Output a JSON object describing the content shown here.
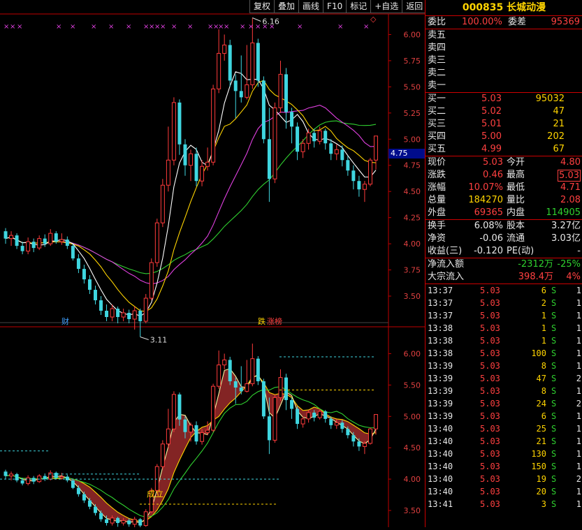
{
  "toolbar": {
    "buttons": [
      "复权",
      "叠加",
      "画线",
      "F10",
      "标记",
      "+自选",
      "返回"
    ]
  },
  "stock": {
    "code": "000835",
    "name": "长城动漫"
  },
  "main_chart": {
    "price_axis": [
      "6.00",
      "5.75",
      "5.50",
      "5.25",
      "5.00",
      "4.75",
      "4.50",
      "4.25",
      "4.00",
      "3.75",
      "3.50"
    ],
    "current_price_tag": "4.75",
    "high_label": "6.16",
    "low_label": "3.11",
    "event_marks": [
      "财",
      "跌",
      "涨榜"
    ]
  },
  "sub_chart": {
    "price_axis": [
      "6.00",
      "5.50",
      "5.00",
      "4.50",
      "4.00",
      "3.50"
    ],
    "annotation": "成立"
  },
  "quote": {
    "weibi_label": "委比",
    "weibi_value": "100.00%",
    "weicha_label": "委差",
    "weicha_value": "95369",
    "asks": [
      {
        "label": "卖五"
      },
      {
        "label": "卖四"
      },
      {
        "label": "卖三"
      },
      {
        "label": "卖二"
      },
      {
        "label": "卖一"
      }
    ],
    "bids": [
      {
        "label": "买一",
        "price": "5.03",
        "vol": "95032"
      },
      {
        "label": "买二",
        "price": "5.02",
        "vol": "47"
      },
      {
        "label": "买三",
        "price": "5.01",
        "vol": "21"
      },
      {
        "label": "买四",
        "price": "5.00",
        "vol": "202"
      },
      {
        "label": "买五",
        "price": "4.99",
        "vol": "67"
      }
    ],
    "stats": [
      {
        "l1": "现价",
        "v1": "5.03",
        "c1": "red",
        "l2": "今开",
        "v2": "4.80",
        "c2": "red"
      },
      {
        "l1": "涨跌",
        "v1": "0.46",
        "c1": "red",
        "l2": "最高",
        "v2": "5.03",
        "c2": "red"
      },
      {
        "l1": "涨幅",
        "v1": "10.07%",
        "c1": "red",
        "l2": "最低",
        "v2": "4.71",
        "c2": "red"
      },
      {
        "l1": "总量",
        "v1": "184270",
        "c1": "yellow",
        "l2": "量比",
        "v2": "2.08",
        "c2": "red"
      },
      {
        "l1": "外盘",
        "v1": "69365",
        "c1": "red",
        "l2": "内盘",
        "v2": "114905",
        "c2": "green"
      }
    ],
    "stats2": [
      {
        "l1": "换手",
        "v1": "6.08%",
        "l2": "股本",
        "v2": "3.27亿"
      },
      {
        "l1": "净资",
        "v1": "-0.06",
        "l2": "流通",
        "v2": "3.03亿"
      },
      {
        "l1": "收益(三)",
        "v1": "-0.120",
        "l2": "PE(动)",
        "v2": "-"
      }
    ],
    "flow": [
      {
        "label": "净流入额",
        "value": "-2312万",
        "pct": "-25%",
        "vcolor": "green",
        "pcolor": "green"
      },
      {
        "label": "大宗流入",
        "value": "398.4万",
        "pct": "4%",
        "vcolor": "red",
        "pcolor": "red"
      }
    ]
  },
  "ticks": [
    {
      "time": "13:37",
      "price": "5.03",
      "vol": "6",
      "side": "S",
      "n": "1"
    },
    {
      "time": "13:37",
      "price": "5.03",
      "vol": "2",
      "side": "S",
      "n": "1"
    },
    {
      "time": "13:37",
      "price": "5.03",
      "vol": "1",
      "side": "S",
      "n": "1"
    },
    {
      "time": "13:38",
      "price": "5.03",
      "vol": "1",
      "side": "S",
      "n": "1"
    },
    {
      "time": "13:38",
      "price": "5.03",
      "vol": "1",
      "side": "S",
      "n": "1"
    },
    {
      "time": "13:38",
      "price": "5.03",
      "vol": "100",
      "side": "S",
      "n": "1"
    },
    {
      "time": "13:39",
      "price": "5.03",
      "vol": "8",
      "side": "S",
      "n": "1"
    },
    {
      "time": "13:39",
      "price": "5.03",
      "vol": "47",
      "side": "S",
      "n": "2"
    },
    {
      "time": "13:39",
      "price": "5.03",
      "vol": "8",
      "side": "S",
      "n": "1"
    },
    {
      "time": "13:39",
      "price": "5.03",
      "vol": "24",
      "side": "S",
      "n": "2"
    },
    {
      "time": "13:39",
      "price": "5.03",
      "vol": "6",
      "side": "S",
      "n": "1"
    },
    {
      "time": "13:40",
      "price": "5.03",
      "vol": "25",
      "side": "S",
      "n": "1"
    },
    {
      "time": "13:40",
      "price": "5.03",
      "vol": "21",
      "side": "S",
      "n": "1"
    },
    {
      "time": "13:40",
      "price": "5.03",
      "vol": "130",
      "side": "S",
      "n": "1"
    },
    {
      "time": "13:40",
      "price": "5.03",
      "vol": "150",
      "side": "S",
      "n": "1"
    },
    {
      "time": "13:40",
      "price": "5.03",
      "vol": "19",
      "side": "S",
      "n": "2"
    },
    {
      "time": "13:40",
      "price": "5.03",
      "vol": "20",
      "side": "S",
      "n": "1"
    },
    {
      "time": "13:41",
      "price": "5.03",
      "vol": "3",
      "side": "S",
      "n": "1"
    }
  ],
  "colors": {
    "up": "#ff3b3b",
    "down": "#3fd6e0",
    "ma5": "#ffffff",
    "ma10": "#ffd400",
    "ma20": "#e040e0",
    "ma60": "#30d030",
    "border": "#c00000"
  },
  "chart_data": {
    "type": "candlestick",
    "ma_lines": [
      "MA5",
      "MA10",
      "MA20",
      "MA60"
    ],
    "ylim_main": [
      3.3,
      6.25
    ],
    "ylim_sub": [
      3.3,
      6.25
    ],
    "candles": [
      [
        4.12,
        4.05,
        4.15,
        4.0
      ],
      [
        4.05,
        4.08,
        4.12,
        3.98
      ],
      [
        4.08,
        3.98,
        4.1,
        3.95
      ],
      [
        3.98,
        3.93,
        4.02,
        3.9
      ],
      [
        3.93,
        4.02,
        4.06,
        3.9
      ],
      [
        4.02,
        3.96,
        4.05,
        3.92
      ],
      [
        3.96,
        4.05,
        4.08,
        3.94
      ],
      [
        4.05,
        4.0,
        4.09,
        3.97
      ],
      [
        4.0,
        4.1,
        4.14,
        3.98
      ],
      [
        4.1,
        4.02,
        4.12,
        4.0
      ],
      [
        4.02,
        4.04,
        4.1,
        3.99
      ],
      [
        4.04,
        3.98,
        4.07,
        3.95
      ],
      [
        3.98,
        3.86,
        4.0,
        3.84
      ],
      [
        3.86,
        3.76,
        3.9,
        3.72
      ],
      [
        3.76,
        3.66,
        3.8,
        3.62
      ],
      [
        3.66,
        3.56,
        3.7,
        3.52
      ],
      [
        3.56,
        3.46,
        3.6,
        3.42
      ],
      [
        3.46,
        3.36,
        3.5,
        3.32
      ],
      [
        3.36,
        3.3,
        3.42,
        3.26
      ],
      [
        3.3,
        3.38,
        3.42,
        3.26
      ],
      [
        3.38,
        3.3,
        3.4,
        3.24
      ],
      [
        3.3,
        3.34,
        3.38,
        3.26
      ],
      [
        3.34,
        3.28,
        3.37,
        3.24
      ],
      [
        3.28,
        3.36,
        3.4,
        3.18
      ],
      [
        3.36,
        3.26,
        3.38,
        3.11
      ],
      [
        3.26,
        3.48,
        3.52,
        3.24
      ],
      [
        3.48,
        3.82,
        3.86,
        3.46
      ],
      [
        3.82,
        4.2,
        4.24,
        3.78
      ],
      [
        4.2,
        4.56,
        4.62,
        4.16
      ],
      [
        4.56,
        4.8,
        5.12,
        4.5
      ],
      [
        4.8,
        5.35,
        5.4,
        4.75
      ],
      [
        5.35,
        4.95,
        5.38,
        4.85
      ],
      [
        4.95,
        4.75,
        5.0,
        4.65
      ],
      [
        4.75,
        4.86,
        4.9,
        4.6
      ],
      [
        4.86,
        4.6,
        4.92,
        4.55
      ],
      [
        4.6,
        4.74,
        4.8,
        4.55
      ],
      [
        4.74,
        4.78,
        4.92,
        4.7
      ],
      [
        4.78,
        5.48,
        5.52,
        4.75
      ],
      [
        5.48,
        5.82,
        6.05,
        5.44
      ],
      [
        5.82,
        5.9,
        6.0,
        5.75
      ],
      [
        5.9,
        5.56,
        5.95,
        5.5
      ],
      [
        5.56,
        5.46,
        5.62,
        5.2
      ],
      [
        5.46,
        5.4,
        5.8,
        5.35
      ],
      [
        5.4,
        5.52,
        5.9,
        5.38
      ],
      [
        5.52,
        5.92,
        6.16,
        5.48
      ],
      [
        5.92,
        5.56,
        5.96,
        5.5
      ],
      [
        5.56,
        5.0,
        5.6,
        4.96
      ],
      [
        5.0,
        4.62,
        5.3,
        4.4
      ],
      [
        4.62,
        5.3,
        5.35,
        4.58
      ],
      [
        5.3,
        5.62,
        5.75,
        5.25
      ],
      [
        5.62,
        5.26,
        5.68,
        5.1
      ],
      [
        5.26,
        5.12,
        5.3,
        4.96
      ],
      [
        5.12,
        4.88,
        5.16,
        4.8
      ],
      [
        4.88,
        4.96,
        5.0,
        4.82
      ],
      [
        4.96,
        5.06,
        5.1,
        4.9
      ],
      [
        5.06,
        4.98,
        5.1,
        4.92
      ],
      [
        4.98,
        5.08,
        5.12,
        4.95
      ],
      [
        5.08,
        4.96,
        5.1,
        4.9
      ],
      [
        4.96,
        4.86,
        5.0,
        4.8
      ],
      [
        4.86,
        4.9,
        4.95,
        4.8
      ],
      [
        4.9,
        4.8,
        4.94,
        4.74
      ],
      [
        4.8,
        4.7,
        4.84,
        4.65
      ],
      [
        4.7,
        4.6,
        4.75,
        4.52
      ],
      [
        4.6,
        4.52,
        4.65,
        4.45
      ],
      [
        4.52,
        4.57,
        4.6,
        4.4
      ],
      [
        4.57,
        4.8,
        4.82,
        4.55
      ],
      [
        4.8,
        5.03,
        5.03,
        4.71
      ]
    ]
  }
}
